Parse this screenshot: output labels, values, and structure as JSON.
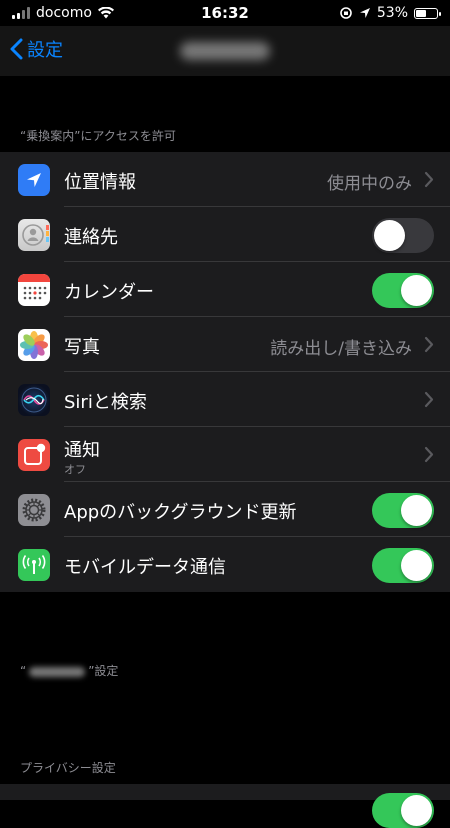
{
  "status_bar": {
    "carrier": "docomo",
    "time": "16:32",
    "battery": "53%",
    "battery_level": 0.53
  },
  "nav": {
    "back_label": "設定"
  },
  "sections": {
    "access_header": "“乗換案内”にアクセスを許可",
    "app_settings_header_prefix": "“",
    "app_settings_header_suffix": "”設定",
    "privacy_header": "プライバシー設定"
  },
  "rows": {
    "location": {
      "label": "位置情報",
      "value": "使用中のみ",
      "icon": "location-arrow-icon",
      "color": "#2f7cf6"
    },
    "contacts": {
      "label": "連絡先",
      "toggle": false,
      "icon": "contacts-icon"
    },
    "calendar": {
      "label": "カレンダー",
      "toggle": true,
      "icon": "calendar-icon"
    },
    "photos": {
      "label": "写真",
      "value": "読み出し/書き込み",
      "icon": "photos-icon"
    },
    "siri": {
      "label": "Siriと検索",
      "icon": "siri-icon"
    },
    "notifications": {
      "label": "通知",
      "sub": "オフ",
      "icon": "notification-icon",
      "color": "#ee4b42"
    },
    "background_refresh": {
      "label": "Appのバックグラウンド更新",
      "toggle": true,
      "icon": "gear-icon"
    },
    "mobile_data": {
      "label": "モバイルデータ通信",
      "toggle": true,
      "icon": "antenna-icon",
      "color": "#34c759"
    }
  },
  "colors": {
    "accent": "#0a84ff",
    "toggle_on": "#34c759",
    "cell": "#1c1c1e"
  }
}
